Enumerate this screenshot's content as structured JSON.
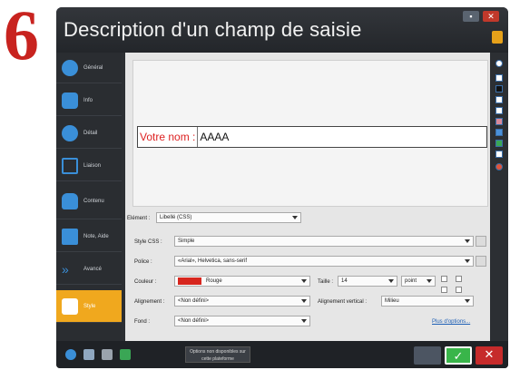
{
  "step_number": "6",
  "window": {
    "title": "Description d'un champ de saisie"
  },
  "sidebar": {
    "items": [
      {
        "label": "Général",
        "icon": "info-circle-icon",
        "color": "#3a8fd8"
      },
      {
        "label": "Info",
        "icon": "chat-bubbles-icon",
        "color": "#3a8fd8"
      },
      {
        "label": "Détail",
        "icon": "detail-circle-icon",
        "color": "#3a8fd8"
      },
      {
        "label": "Liaison",
        "icon": "window-link-icon",
        "color": "#3a8fd8"
      },
      {
        "label": "Contenu",
        "icon": "bottle-icon",
        "color": "#3a8fd8"
      },
      {
        "label": "Note, Aide",
        "icon": "note-icon",
        "color": "#3a8fd8"
      },
      {
        "label": "Avancé",
        "icon": "chevrons-right-icon",
        "color": "#3a8fd8"
      },
      {
        "label": "Style",
        "icon": "style-icon",
        "color": "#f0a81e",
        "active": true
      }
    ]
  },
  "preview": {
    "label": "Votre nom :",
    "value": "AAAA"
  },
  "element": {
    "label": "Elément :",
    "value": "Libellé (CSS)"
  },
  "style_css": {
    "label": "Style CSS :",
    "value": "Simple"
  },
  "font": {
    "label": "Police :",
    "value": "«Arial», Helvetica, sans-serif"
  },
  "color": {
    "label": "Couleur :",
    "value": "Rouge",
    "swatch": "#d7261e"
  },
  "size": {
    "label": "Taille :",
    "value": "14",
    "unit": "point"
  },
  "alignment": {
    "label": "Alignement :",
    "value": "<Non défini>"
  },
  "vertical_alignment": {
    "label": "Alignement vertical :",
    "value": "Milieu"
  },
  "background": {
    "label": "Fond :",
    "value": "<Non défini>"
  },
  "more_options_link": "Plus d'options...",
  "notice": "Options non disponibles sur cette plateforme",
  "colors": {
    "titlebar": "#2c2f33",
    "accent": "#f0a81e",
    "ok": "#39b54a",
    "close": "#c62b2b"
  }
}
